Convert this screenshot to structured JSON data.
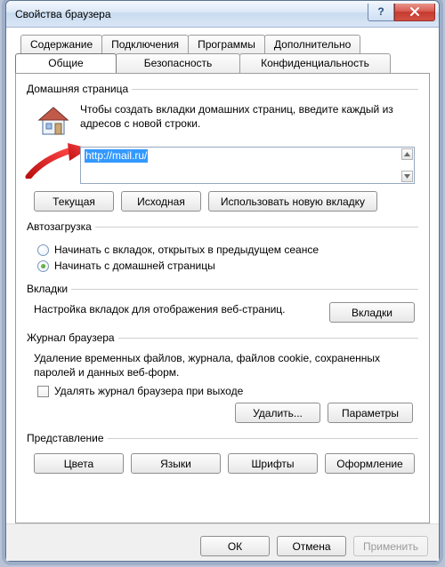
{
  "window": {
    "title": "Свойства браузера"
  },
  "caption": {
    "help": "?",
    "close": "✕"
  },
  "tabs_row1": [
    {
      "label": "Содержание"
    },
    {
      "label": "Подключения"
    },
    {
      "label": "Программы"
    },
    {
      "label": "Дополнительно"
    }
  ],
  "tabs_row2": [
    {
      "label": "Общие"
    },
    {
      "label": "Безопасность"
    },
    {
      "label": "Конфиденциальность"
    }
  ],
  "home": {
    "legend": "Домашняя страница",
    "desc": "Чтобы создать вкладки домашних страниц, введите каждый из адресов с новой строки.",
    "url": "http://mail.ru/",
    "btn_current": "Текущая",
    "btn_default": "Исходная",
    "btn_newtab": "Использовать новую вкладку"
  },
  "autostart": {
    "legend": "Автозагрузка",
    "opt_last": "Начинать с вкладок, открытых в предыдущем сеансе",
    "opt_home": "Начинать с домашней страницы"
  },
  "tabs_group": {
    "legend": "Вкладки",
    "desc": "Настройка вкладок для отображения веб-страниц.",
    "btn": "Вкладки"
  },
  "history": {
    "legend": "Журнал браузера",
    "desc": "Удаление временных файлов, журнала, файлов cookie, сохраненных паролей и данных веб-форм.",
    "chk": "Удалять журнал браузера при выходе",
    "btn_delete": "Удалить...",
    "btn_params": "Параметры"
  },
  "appearance": {
    "legend": "Представление",
    "btn_colors": "Цвета",
    "btn_langs": "Языки",
    "btn_fonts": "Шрифты",
    "btn_style": "Оформление"
  },
  "dialog": {
    "ok": "ОК",
    "cancel": "Отмена",
    "apply": "Применить"
  }
}
